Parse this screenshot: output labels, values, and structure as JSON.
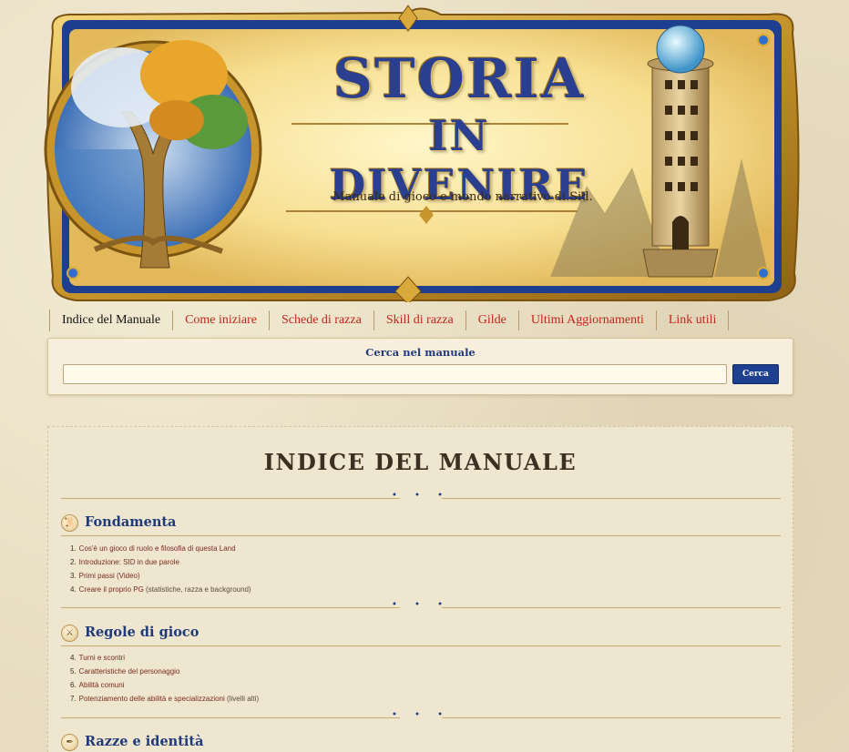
{
  "banner": {
    "title_line1": "STORIA",
    "title_line2": "IN DIVENIRE",
    "subtitle": "Manuale di gioco e mondo narrativo di.Sid."
  },
  "nav": {
    "items": [
      {
        "label": "Indice del Manuale"
      },
      {
        "label": "Come iniziare"
      },
      {
        "label": "Schede di razza"
      },
      {
        "label": "Skill di razza"
      },
      {
        "label": "Gilde"
      },
      {
        "label": "Ultimi Aggiornamenti"
      },
      {
        "label": "Link utili"
      }
    ]
  },
  "search": {
    "label": "Cerca nel manuale",
    "value": "",
    "button_label": "Cerca"
  },
  "main": {
    "title": "INDICE DEL MANUALE",
    "ornament": "• • •",
    "sections": [
      {
        "icon": "scroll-icon",
        "title": "Fondamenta",
        "items": [
          {
            "num": "1.",
            "text": "Cos'è un gioco di ruolo e filosofia di questa Land",
            "note": ""
          },
          {
            "num": "2.",
            "text": "Introduzione: SID in due parole",
            "note": ""
          },
          {
            "num": "3.",
            "text": "Primi passi (Video)",
            "note": ""
          },
          {
            "num": "4.",
            "text": "Creare il proprio PG",
            "note": "(statistiche, razza e background)"
          }
        ]
      },
      {
        "icon": "crossed-swords-icon",
        "title": "Regole di gioco",
        "items": [
          {
            "num": "4.",
            "text": "Turni e scontri",
            "note": ""
          },
          {
            "num": "5.",
            "text": "Caratteristiche del personaggio",
            "note": ""
          },
          {
            "num": "6.",
            "text": "Abilità comuni",
            "note": ""
          },
          {
            "num": "7.",
            "text": "Potenziamento delle abilità e specializzazioni",
            "note": "(livelli alti)"
          }
        ]
      },
      {
        "icon": "feather-icon",
        "title": "Razze e identità",
        "items": []
      }
    ]
  },
  "colors": {
    "nav_link": "#c0251b",
    "heading_blue": "#1f3a7a",
    "list_link": "#7a2b1d",
    "button_bg": "#1f3f8f"
  }
}
